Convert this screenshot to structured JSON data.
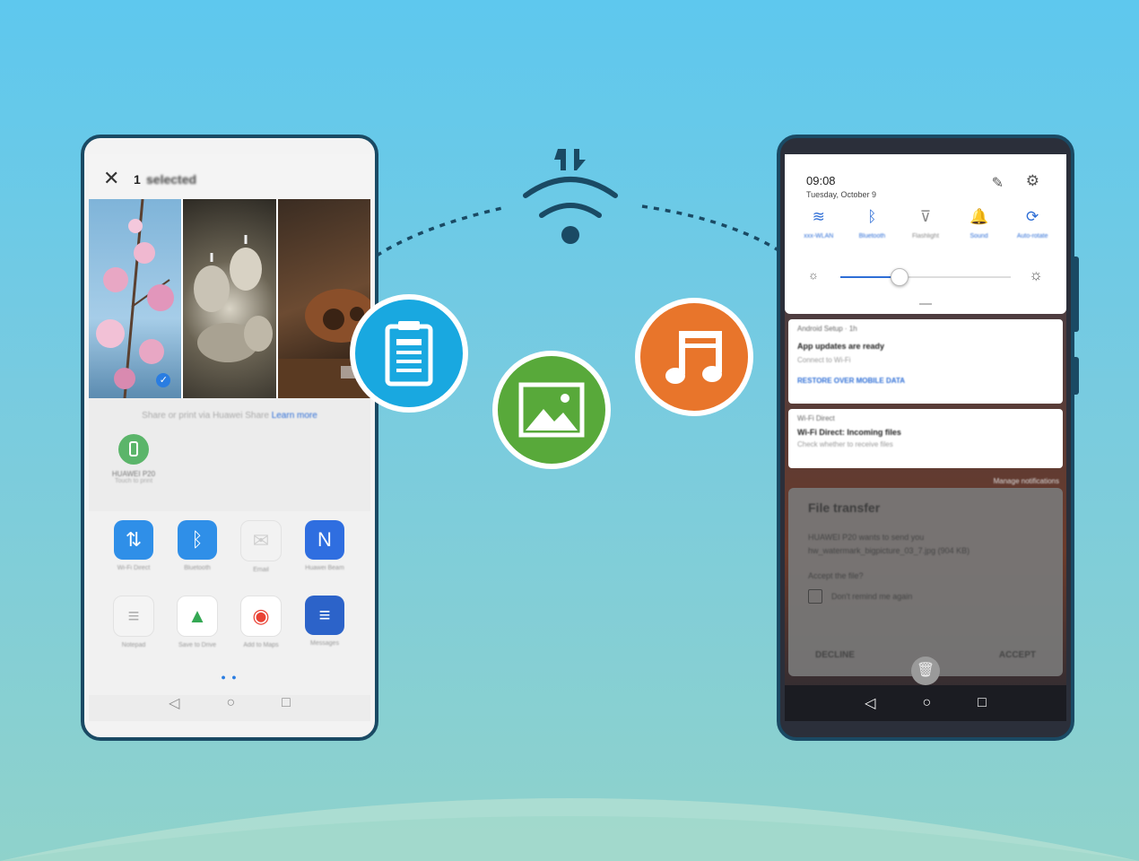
{
  "scene": {
    "colors": {
      "sky_top": "#5ec8ee",
      "sky_bottom": "#8fd2cb",
      "phone_frame": "#1a4a64",
      "doc_badge": "#19a8e0",
      "image_badge": "#58a93a",
      "music_badge": "#e8752b"
    },
    "icons": [
      "data-transfer-arrows-icon",
      "wifi-signal-icon",
      "document-icon",
      "image-icon",
      "music-note-icon"
    ]
  },
  "left_phone": {
    "close": "✕",
    "selected_count": "1",
    "selected_label": "selected",
    "hint": "Share or print via Huawei Share",
    "hint_link": "Learn more",
    "device": {
      "name": "HUAWEI P20",
      "sub": "Touch to print"
    },
    "apps": [
      {
        "label": "Wi-Fi Direct",
        "icon": "wifi-direct-icon",
        "color": "#2f8fe8"
      },
      {
        "label": "Bluetooth",
        "icon": "bluetooth-icon",
        "color": "#2f8fe8"
      },
      {
        "label": "Email",
        "icon": "email-icon",
        "color": "#f2f2f2"
      },
      {
        "label": "Huawei Beam",
        "icon": "nfc-icon",
        "color": "#2f6ee0"
      },
      {
        "label": "Notepad",
        "icon": "notepad-icon",
        "color": "#f4f4f4"
      },
      {
        "label": "Save to Drive",
        "icon": "google-drive-icon",
        "color": "#ffffff"
      },
      {
        "label": "Add to Maps",
        "icon": "google-maps-icon",
        "color": "#ffffff"
      },
      {
        "label": "Messages",
        "icon": "messages-icon",
        "color": "#2c63c9"
      }
    ],
    "page_dots": "● ●",
    "nav": {
      "back": "◁",
      "home": "○",
      "recent": "□"
    }
  },
  "right_phone": {
    "time": "09:08",
    "date": "Tuesday, October 9",
    "edit_icon": "✎",
    "settings_icon": "⚙",
    "tiles": [
      {
        "label": "xxx-WLAN",
        "glyph": "≋",
        "on": true
      },
      {
        "label": "Bluetooth",
        "glyph": "ᛒ",
        "on": true
      },
      {
        "label": "Flashlight",
        "glyph": "⊽",
        "on": false
      },
      {
        "label": "Sound",
        "glyph": "🔔",
        "on": true
      },
      {
        "label": "Auto-rotate",
        "glyph": "⟳",
        "on": true
      }
    ],
    "brightness": {
      "low_icon": "☼",
      "high_icon": "☼",
      "level_percent": 34
    },
    "notifications": [
      {
        "app": "Android Setup · 1h",
        "title": "App updates are ready",
        "body": "Connect to Wi-Fi",
        "action": "RESTORE OVER MOBILE DATA"
      },
      {
        "app": "Wi-Fi Direct",
        "title": "Wi-Fi Direct: Incoming files",
        "body": "Check whether to receive files"
      }
    ],
    "manage_notifications": "Manage notifications",
    "dialog": {
      "title": "File transfer",
      "body_line1": "HUAWEI P20 wants to send you",
      "body_line2": "hw_watermark_bigpicture_03_7.jpg (904 KB)",
      "question": "Accept the file?",
      "checkbox": "Don't remind me again",
      "decline": "DECLINE",
      "accept": "ACCEPT"
    },
    "trash_icon": "🗑",
    "nav": {
      "back": "◁",
      "home": "○",
      "recent": "□"
    }
  }
}
